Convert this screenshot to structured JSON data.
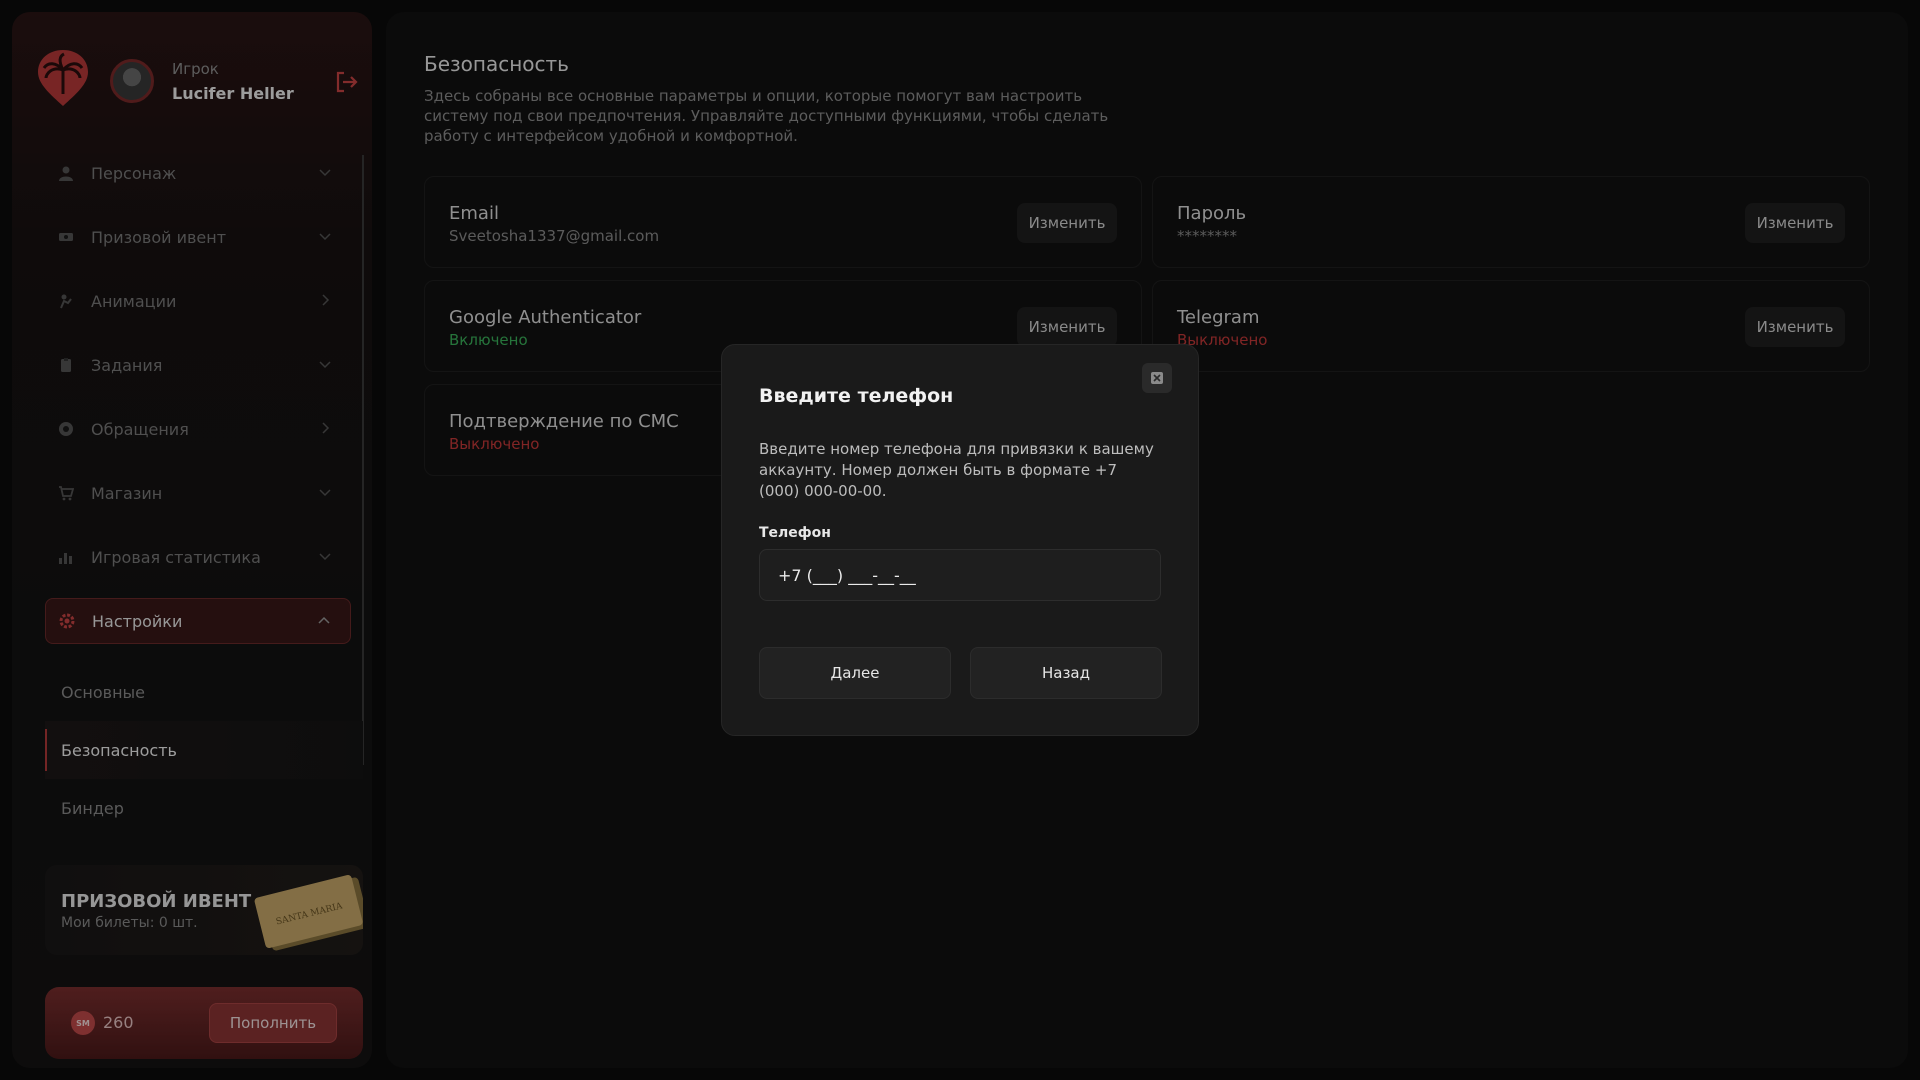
{
  "profile": {
    "role": "Игрок",
    "name": "Lucifer Heller"
  },
  "menu": {
    "items": [
      {
        "label": "Персонаж",
        "icon": "person-icon"
      },
      {
        "label": "Призовой ивент",
        "icon": "ticket-icon"
      },
      {
        "label": "Анимации",
        "icon": "animation-icon"
      },
      {
        "label": "Задания",
        "icon": "tasks-icon"
      },
      {
        "label": "Обращения",
        "icon": "support-icon"
      },
      {
        "label": "Магазин",
        "icon": "cart-icon"
      },
      {
        "label": "Игровая статистика",
        "icon": "stats-icon"
      },
      {
        "label": "Настройки",
        "icon": "gear-icon"
      }
    ],
    "sub_items": [
      {
        "label": "Основные"
      },
      {
        "label": "Безопасность"
      },
      {
        "label": "Биндер"
      }
    ]
  },
  "event_card": {
    "title": "ПРИЗОВОЙ ИВЕНТ",
    "subtitle": "Мои билеты: 0 шт.",
    "ticket_text": "SANTA MARIA"
  },
  "balance": {
    "coin_label": "SM",
    "amount": "260",
    "topup_label": "Пополнить"
  },
  "page": {
    "title": "Безопасность",
    "description": "Здесь собраны все основные параметры и опции, которые помогут вам настроить систему под свои предпочтения. Управляйте доступными функциями, чтобы сделать работу с интерфейсом удобной и комфортной."
  },
  "cards": {
    "email": {
      "title": "Email",
      "value": "Sveetosha1337@gmail.com",
      "button": "Изменить"
    },
    "password": {
      "title": "Пароль",
      "value": "********",
      "button": "Изменить"
    },
    "google": {
      "title": "Google Authenticator",
      "value": "Включено",
      "button": "Изменить"
    },
    "telegram": {
      "title": "Telegram",
      "value": "Выключено",
      "button": "Изменить"
    },
    "sms": {
      "title": "Подтверждение по СМС",
      "value": "Выключено"
    }
  },
  "modal": {
    "title": "Введите телефон",
    "text": "Введите номер телефона для привязки к вашему аккаунту. Номер должен быть в формате +7 (000) 000-00-00.",
    "label": "Телефон",
    "input_value": "+7 (___) ___-__-__",
    "next_label": "Далее",
    "back_label": "Назад"
  },
  "colors": {
    "accent": "#b23a3a",
    "on": "#3bb35b",
    "off": "#c73a3a"
  }
}
